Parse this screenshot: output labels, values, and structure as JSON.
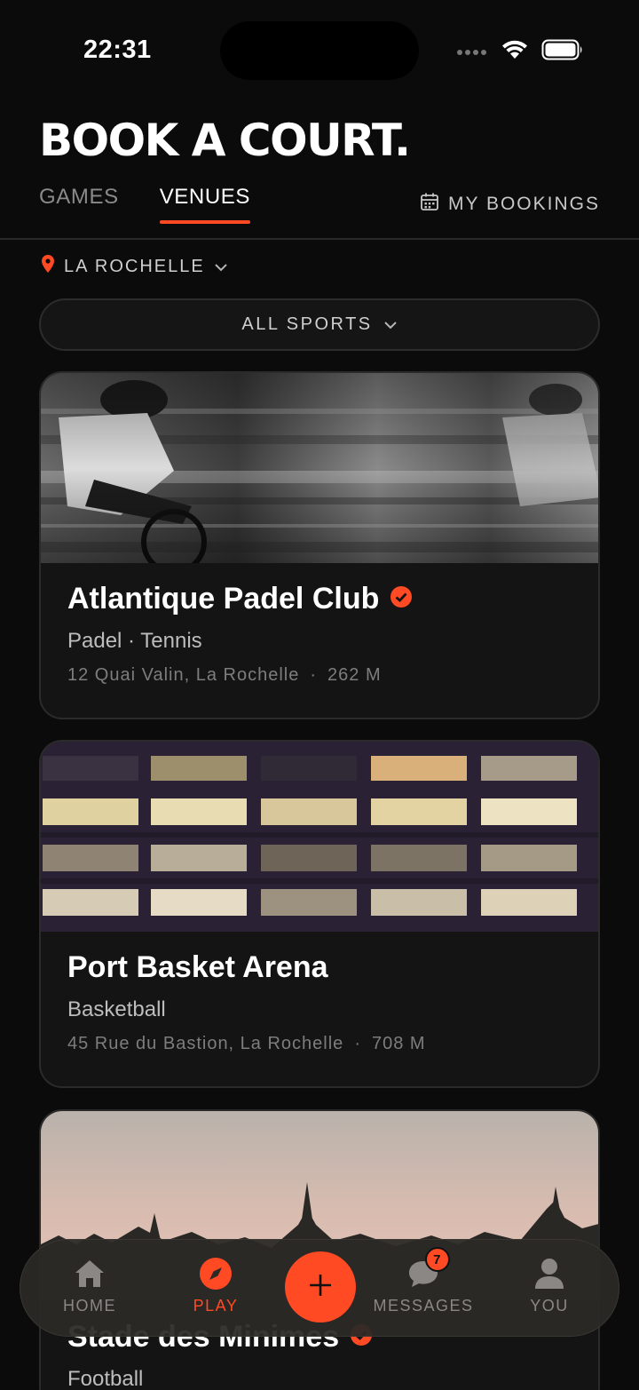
{
  "status": {
    "time": "22:31"
  },
  "header": {
    "title": "BOOK A COURT.",
    "tabs": [
      {
        "label": "GAMES",
        "active": false
      },
      {
        "label": "VENUES",
        "active": true
      }
    ],
    "my_bookings_label": "MY BOOKINGS"
  },
  "location": {
    "label": "LA ROCHELLE"
  },
  "filter": {
    "sports_label": "ALL SPORTS"
  },
  "venues": [
    {
      "name": "Atlantique Padel Club",
      "verified": true,
      "sports": "Padel · Tennis",
      "address": "12 Quai Valin, La Rochelle",
      "distance": "262 M"
    },
    {
      "name": "Port Basket Arena",
      "verified": false,
      "sports": "Basketball",
      "address": "45 Rue du Bastion, La Rochelle",
      "distance": "708 M"
    },
    {
      "name": "Stade des Minimes",
      "verified": true,
      "sports": "Football",
      "address": "",
      "distance": ""
    }
  ],
  "tabbar": {
    "items": [
      {
        "label": "HOME",
        "icon": "home-icon"
      },
      {
        "label": "PLAY",
        "icon": "compass-icon",
        "active": true
      },
      {
        "label": "MESSAGES",
        "icon": "chat-icon",
        "badge": "7"
      },
      {
        "label": "YOU",
        "icon": "person-icon"
      }
    ]
  },
  "colors": {
    "accent": "#ff4a24",
    "background": "#0b0b0b",
    "card": "#141414"
  }
}
